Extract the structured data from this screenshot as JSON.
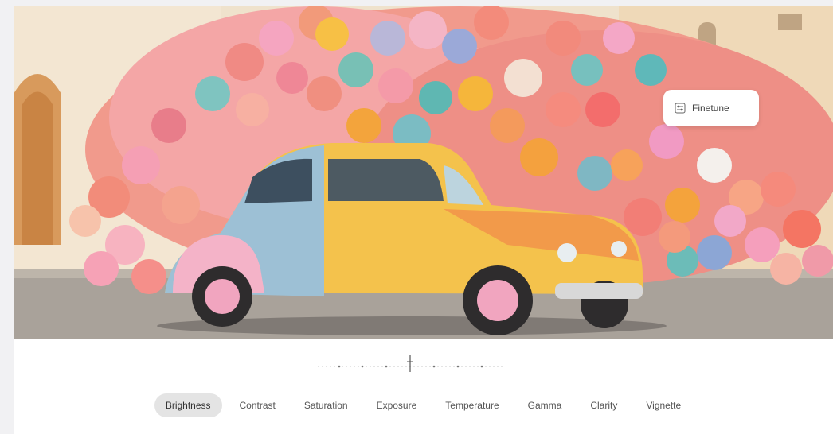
{
  "finetune": {
    "label": "Finetune",
    "icon": "sliders-icon"
  },
  "scale": {
    "value": 0.5
  },
  "filters": [
    {
      "label": "Brightness",
      "active": true
    },
    {
      "label": "Contrast",
      "active": false
    },
    {
      "label": "Saturation",
      "active": false
    },
    {
      "label": "Exposure",
      "active": false
    },
    {
      "label": "Temperature",
      "active": false
    },
    {
      "label": "Gamma",
      "active": false
    },
    {
      "label": "Clarity",
      "active": false
    },
    {
      "label": "Vignette",
      "active": false
    }
  ]
}
